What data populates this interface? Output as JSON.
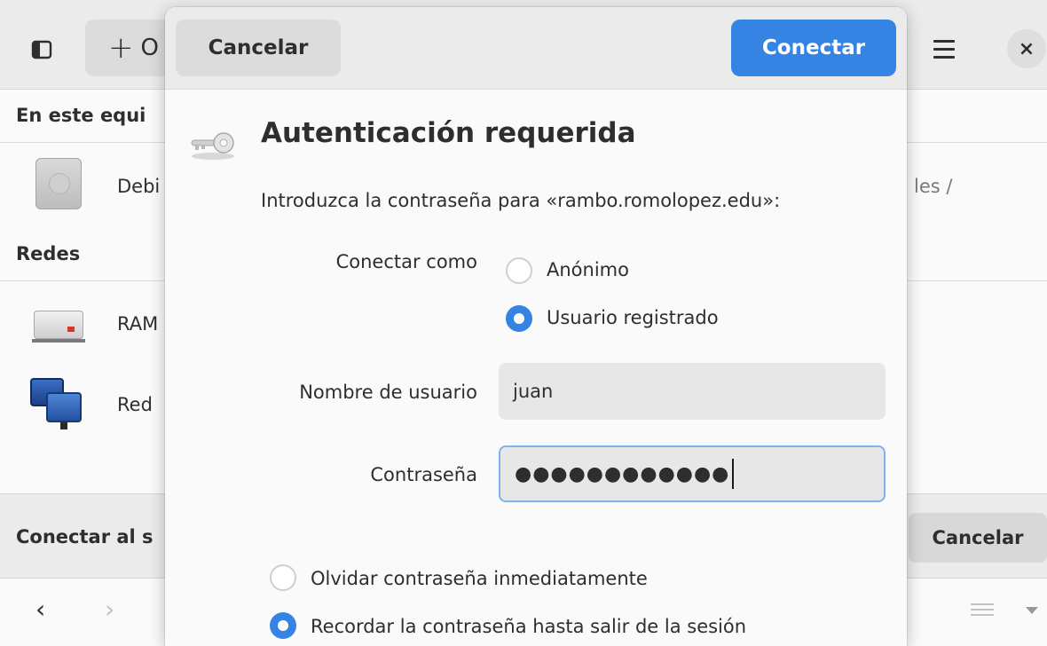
{
  "background_window": {
    "header": {
      "other_locations_label": "O",
      "menu_icon": "hamburger-menu-icon",
      "close_icon": "close-icon"
    },
    "sections": {
      "this_computer": "En este equi",
      "networks": "Redes"
    },
    "items": {
      "disk": "Debi",
      "server": "RAM",
      "network": "Red"
    },
    "breadcrumb": "les    /",
    "bottom_bar": {
      "connect_label": "Conectar al s",
      "cancel_label": "Cancelar"
    },
    "nav": {
      "back": "‹",
      "forward": "›"
    }
  },
  "dialog": {
    "cancel_label": "Cancelar",
    "connect_label": "Conectar",
    "icon": "key-icon",
    "title": "Autenticación requerida",
    "prompt": "Introduzca la contraseña para «rambo.romolopez.edu»:",
    "connect_as_label": "Conectar como",
    "connect_as_options": [
      {
        "label": "Anónimo",
        "selected": false
      },
      {
        "label": "Usuario registrado",
        "selected": true
      }
    ],
    "username_label": "Nombre de usuario",
    "username_value": "juan",
    "password_label": "Contraseña",
    "password_masked": "●●●●●●●●●●●●",
    "remember_options": [
      {
        "label": "Olvidar contraseña inmediatamente",
        "selected": false
      },
      {
        "label": "Recordar la contraseña hasta salir de la sesión",
        "selected": true
      }
    ],
    "accent_color": "#3584e4"
  }
}
